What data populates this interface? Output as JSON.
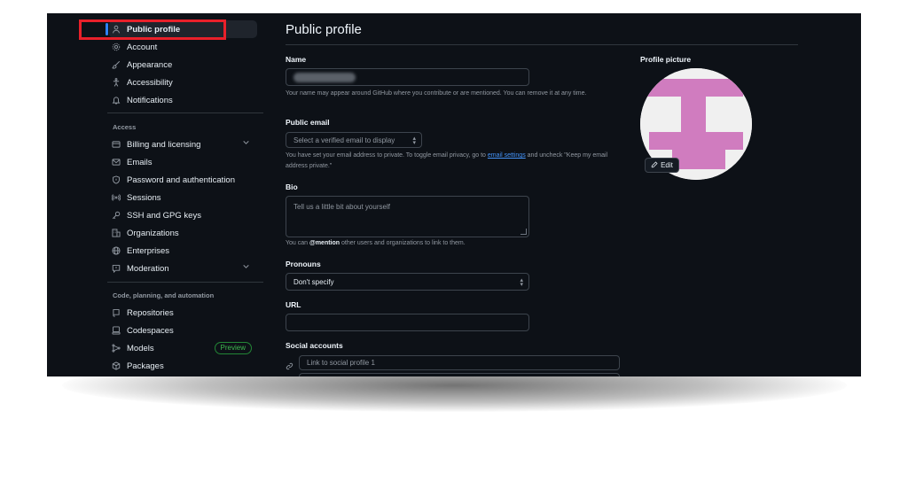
{
  "sidebar": {
    "items": [
      {
        "label": "Public profile",
        "icon": "person-icon"
      },
      {
        "label": "Account",
        "icon": "gear-icon"
      },
      {
        "label": "Appearance",
        "icon": "paintbrush-icon"
      },
      {
        "label": "Accessibility",
        "icon": "accessibility-icon"
      },
      {
        "label": "Notifications",
        "icon": "bell-icon"
      }
    ],
    "access_label": "Access",
    "access_items": [
      {
        "label": "Billing and licensing",
        "icon": "credit-card-icon"
      },
      {
        "label": "Emails",
        "icon": "mail-icon"
      },
      {
        "label": "Password and authentication",
        "icon": "shield-icon"
      },
      {
        "label": "Sessions",
        "icon": "broadcast-icon"
      },
      {
        "label": "SSH and GPG keys",
        "icon": "key-icon"
      },
      {
        "label": "Organizations",
        "icon": "organization-icon"
      },
      {
        "label": "Enterprises",
        "icon": "globe-icon"
      },
      {
        "label": "Moderation",
        "icon": "report-icon"
      }
    ],
    "code_label": "Code, planning, and automation",
    "code_items": [
      {
        "label": "Repositories",
        "icon": "repo-icon"
      },
      {
        "label": "Codespaces",
        "icon": "codespaces-icon"
      },
      {
        "label": "Models",
        "icon": "models-icon",
        "badge": "Preview"
      },
      {
        "label": "Packages",
        "icon": "package-icon"
      }
    ]
  },
  "main": {
    "title": "Public profile",
    "name": {
      "label": "Name",
      "note": "Your name may appear around GitHub where you contribute or are mentioned. You can remove it at any time."
    },
    "public_email": {
      "label": "Public email",
      "placeholder": "Select a verified email to display",
      "note_part1": "You have set your email address to private. To toggle email privacy, go to",
      "note_link": "email settings",
      "note_part2": "and uncheck \"Keep my email address private.\""
    },
    "bio": {
      "label": "Bio",
      "placeholder": "Tell us a little bit about yourself",
      "note_part1": "You can",
      "note_mention": "@mention",
      "note_part2": "other users and organizations to link to them."
    },
    "pronouns": {
      "label": "Pronouns",
      "value": "Don't specify"
    },
    "url": {
      "label": "URL",
      "value": ""
    },
    "social": {
      "label": "Social accounts",
      "placeholder": "Link to social profile 1"
    },
    "profile_picture": {
      "label": "Profile picture",
      "edit_label": "Edit"
    }
  },
  "colors": {
    "background": "#0d1117",
    "accent": "#2f81f7",
    "highlight_box": "#e8202a",
    "avatar_pink": "#d07cbf",
    "preview_green": "#3fb950"
  }
}
